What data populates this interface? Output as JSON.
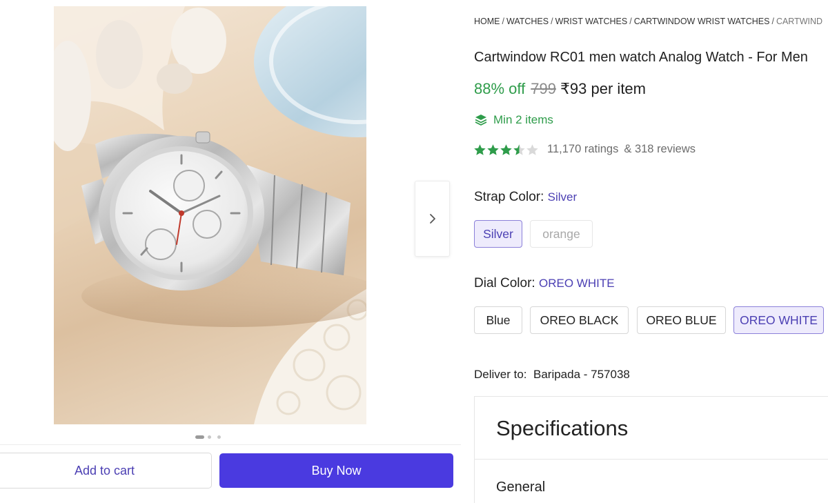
{
  "gallery": {
    "image_label": "Silver analog watch with white dial",
    "dots_total": 3,
    "active_dot": 1
  },
  "breadcrumb": [
    "HOME",
    "WATCHES",
    "WRIST WATCHES",
    "CARTWINDOW WRIST WATCHES",
    "CARTWIND"
  ],
  "product": {
    "title": "Cartwindow RC01 men watch Analog Watch  - For Men",
    "discount": "88% off",
    "mrp": "799",
    "price": "₹93 per item",
    "min_items": "Min 2 items",
    "rating_value": 3.5,
    "ratings": "11,170 ratings",
    "reviews": "& 318 reviews"
  },
  "strap": {
    "label": "Strap Color:",
    "selected": "Silver",
    "options": [
      "Silver",
      "orange"
    ]
  },
  "dial": {
    "label": "Dial Color:",
    "selected": "OREO WHITE",
    "options": [
      "Blue",
      "OREO BLACK",
      "OREO BLUE",
      "OREO WHITE"
    ]
  },
  "delivery": {
    "label": "Deliver to:",
    "location": "Baripada - 757038"
  },
  "specs": {
    "title": "Specifications",
    "section": "General"
  },
  "actions": {
    "add_to_cart": "Add to cart",
    "buy_now": "Buy Now"
  },
  "colors": {
    "accent": "#4a3ae0",
    "discount_green": "#2e9c4a",
    "star_green": "#2e9c4a",
    "selected_chip_bg": "#eeebfc"
  },
  "icons": {
    "next": "chevron-right-icon",
    "min_items": "layers-icon",
    "star": "star-icon"
  }
}
